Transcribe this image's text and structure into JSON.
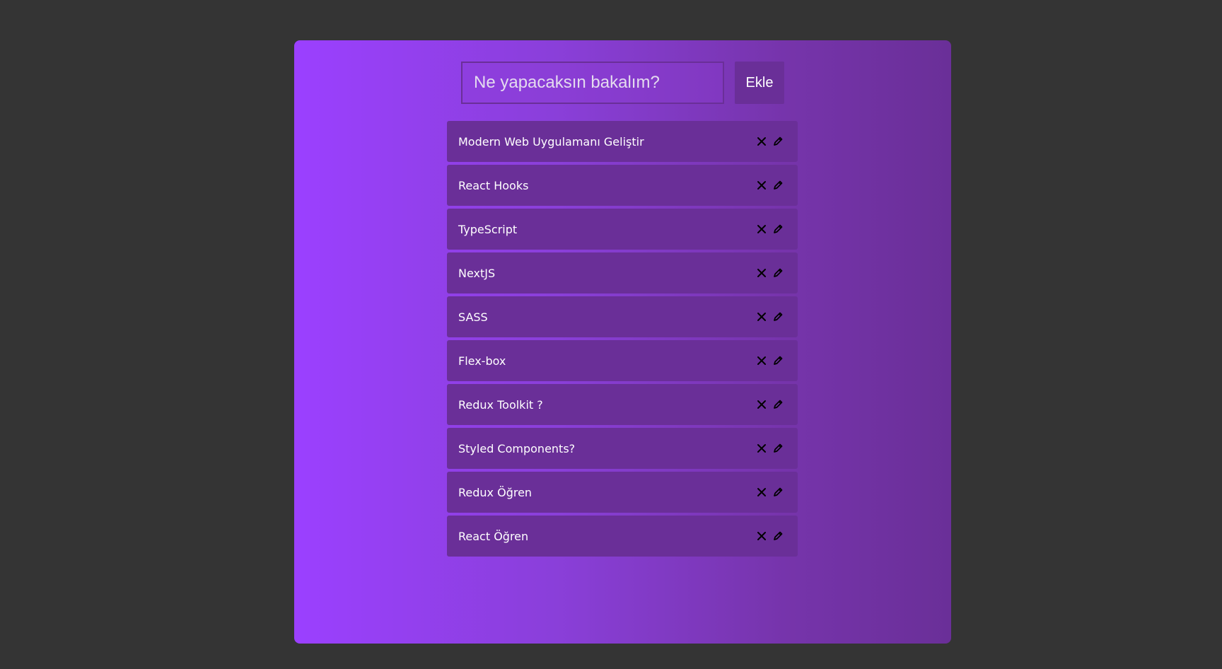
{
  "form": {
    "placeholder": "Ne yapacaksın bakalım?",
    "add_label": "Ekle"
  },
  "todos": [
    {
      "text": "Modern Web Uygulamanı Geliştir"
    },
    {
      "text": "React Hooks"
    },
    {
      "text": "TypeScript"
    },
    {
      "text": "NextJS"
    },
    {
      "text": "SASS"
    },
    {
      "text": "Flex-box"
    },
    {
      "text": "Redux Toolkit ?"
    },
    {
      "text": "Styled Components?"
    },
    {
      "text": "Redux Öğren"
    },
    {
      "text": "React Öğren"
    }
  ],
  "icons": {
    "delete": "close-icon",
    "edit": "pencil-icon"
  },
  "colors": {
    "background": "#343434",
    "panel_gradient_start": "#9b40ff",
    "panel_gradient_end": "#6a2f98",
    "item_background": "#6a2f98",
    "text": "#ffffff"
  }
}
